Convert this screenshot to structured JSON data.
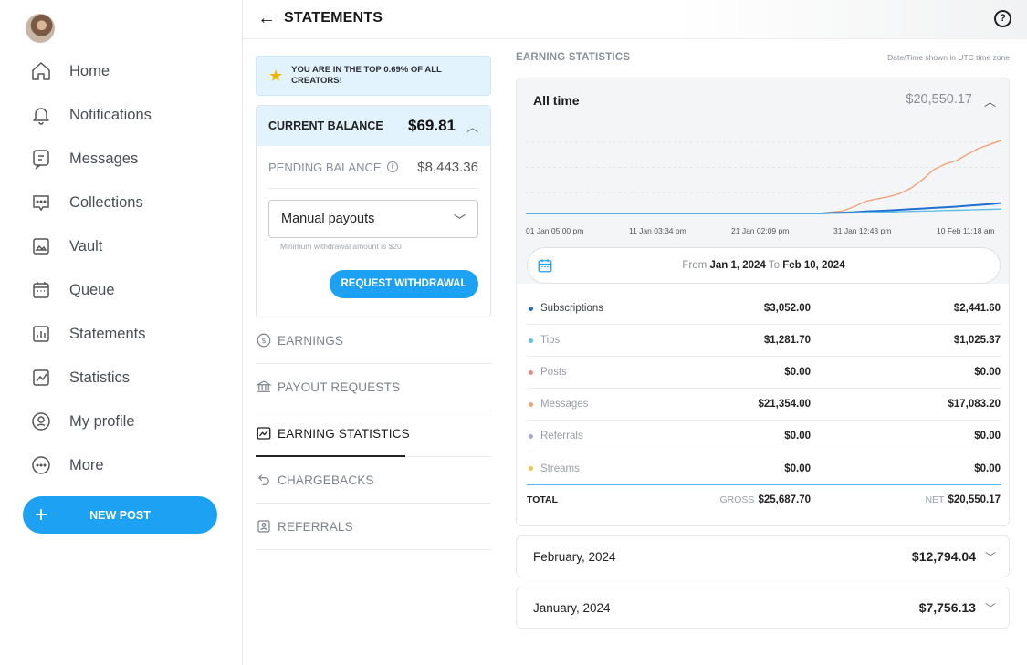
{
  "sidebar": {
    "items": [
      {
        "label": "Home",
        "icon": "home-icon"
      },
      {
        "label": "Notifications",
        "icon": "bell-icon"
      },
      {
        "label": "Messages",
        "icon": "message-icon"
      },
      {
        "label": "Collections",
        "icon": "collections-icon"
      },
      {
        "label": "Vault",
        "icon": "vault-icon"
      },
      {
        "label": "Queue",
        "icon": "calendar-icon"
      },
      {
        "label": "Statements",
        "icon": "statements-icon"
      },
      {
        "label": "Statistics",
        "icon": "statistics-icon"
      },
      {
        "label": "My profile",
        "icon": "profile-icon"
      },
      {
        "label": "More",
        "icon": "more-icon"
      }
    ],
    "new_post": "NEW POST"
  },
  "header": {
    "title": "STATEMENTS",
    "back_icon": "arrow-left-icon",
    "help_icon": "help-icon"
  },
  "left": {
    "banner": "YOU ARE IN THE TOP 0.69% OF ALL CREATORS!",
    "current_balance_label": "CURRENT BALANCE",
    "current_balance": "$69.81",
    "pending_label": "PENDING BALANCE",
    "pending_balance": "$8,443.36",
    "payout_select": "Manual payouts",
    "min_note": "Minimum withdrawal amount is $20",
    "withdraw_button": "REQUEST WITHDRAWAL",
    "menu": [
      {
        "label": "EARNINGS",
        "icon": "dollar-circle-icon"
      },
      {
        "label": "PAYOUT REQUESTS",
        "icon": "bank-icon"
      },
      {
        "label": "EARNING STATISTICS",
        "icon": "chart-icon",
        "active": true
      },
      {
        "label": "CHARGEBACKS",
        "icon": "undo-icon"
      },
      {
        "label": "REFERRALS",
        "icon": "referral-icon"
      }
    ]
  },
  "stats": {
    "section_title": "EARNING STATISTICS",
    "timezone_note": "Date/Time shown in UTC time zone",
    "period_label": "All time",
    "period_amount": "$20,550.17",
    "date_from_label": "From",
    "date_from": "Jan 1, 2024",
    "date_to_label": "To",
    "date_to": "Feb 10, 2024",
    "rows": [
      {
        "name": "Subscriptions",
        "gross": "$3,052.00",
        "net": "$2,441.60",
        "color": "#1f6fd1"
      },
      {
        "name": "Tips",
        "gross": "$1,281.70",
        "net": "$1,025.37",
        "color": "#5ec0e6"
      },
      {
        "name": "Posts",
        "gross": "$0.00",
        "net": "$0.00",
        "color": "#e88a8a"
      },
      {
        "name": "Messages",
        "gross": "$21,354.00",
        "net": "$17,083.20",
        "color": "#f0a37a"
      },
      {
        "name": "Referrals",
        "gross": "$0.00",
        "net": "$0.00",
        "color": "#a6a9d8"
      },
      {
        "name": "Streams",
        "gross": "$0.00",
        "net": "$0.00",
        "color": "#f3c34a"
      }
    ],
    "total_label": "TOTAL",
    "gross_label": "GROSS",
    "gross_total": "$25,687.70",
    "net_label": "NET",
    "net_total": "$20,550.17",
    "months": [
      {
        "label": "February, 2024",
        "amount": "$12,794.04"
      },
      {
        "label": "January, 2024",
        "amount": "$7,756.13"
      }
    ]
  },
  "chart_data": {
    "type": "line",
    "x": [
      "01 Jan 05:00 pm",
      "11 Jan 03:34 pm",
      "21 Jan 02:09 pm",
      "31 Jan 12:43 pm",
      "10 Feb 11:18 am"
    ],
    "series": [
      {
        "name": "Messages",
        "color": "#f0a37a",
        "values": [
          0,
          0,
          0,
          0,
          0,
          0,
          0,
          0,
          0,
          0,
          0,
          0,
          0,
          0,
          0,
          0,
          0,
          0,
          0,
          0,
          0,
          0,
          0,
          0,
          0,
          0,
          0,
          0.3,
          0.6,
          1.6,
          2.8,
          3.4,
          3.9,
          4.6,
          5.9,
          7.8,
          10.2,
          11.5,
          12.3,
          13.8,
          15.2,
          16.1,
          17.08
        ]
      },
      {
        "name": "Subscriptions",
        "color": "#1f6fd1",
        "values": [
          0,
          0,
          0,
          0,
          0,
          0,
          0,
          0,
          0,
          0,
          0,
          0,
          0,
          0,
          0,
          0,
          0,
          0,
          0,
          0,
          0,
          0,
          0,
          0,
          0,
          0,
          0,
          0.1,
          0.2,
          0.3,
          0.5,
          0.6,
          0.7,
          0.85,
          1.0,
          1.15,
          1.3,
          1.45,
          1.6,
          1.8,
          2.0,
          2.2,
          2.44
        ]
      },
      {
        "name": "Tips",
        "color": "#5ec0e6",
        "values": [
          0,
          0,
          0,
          0,
          0,
          0,
          0,
          0,
          0,
          0,
          0,
          0,
          0,
          0,
          0,
          0,
          0,
          0,
          0,
          0,
          0,
          0,
          0,
          0,
          0,
          0,
          0,
          0.05,
          0.1,
          0.15,
          0.25,
          0.3,
          0.35,
          0.4,
          0.5,
          0.55,
          0.6,
          0.7,
          0.75,
          0.8,
          0.9,
          0.95,
          1.03
        ]
      }
    ],
    "ylim": [
      0,
      20
    ],
    "grid": true
  }
}
